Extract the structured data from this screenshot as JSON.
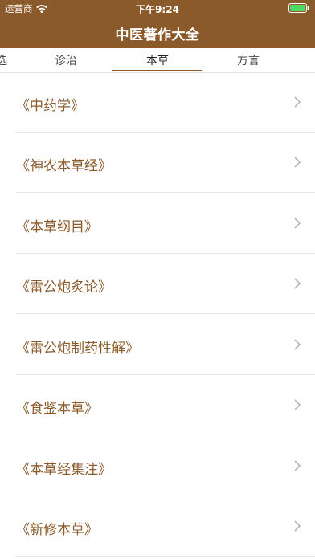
{
  "status_bar": {
    "carrier": "运营商",
    "time": "下午9:24",
    "wifi_icon": "wifi-icon",
    "battery_icon": "battery-icon",
    "battery_color": "#4cd964"
  },
  "header": {
    "title": "中医著作大全",
    "background_color": "#8b5a2b"
  },
  "tabs": [
    {
      "label": "选",
      "active": false
    },
    {
      "label": "诊治",
      "active": false
    },
    {
      "label": "本草",
      "active": true
    },
    {
      "label": "方言",
      "active": false
    }
  ],
  "accent_color": "#8b5a2b",
  "list": {
    "items": [
      {
        "label": "《中药学》"
      },
      {
        "label": "《神农本草经》"
      },
      {
        "label": "《本草纲目》"
      },
      {
        "label": "《雷公炮炙论》"
      },
      {
        "label": "《雷公炮制药性解》"
      },
      {
        "label": "《食鉴本草》"
      },
      {
        "label": "《本草经集注》"
      },
      {
        "label": "《新修本草》"
      }
    ],
    "chevron_icon": "chevron-right-icon"
  }
}
